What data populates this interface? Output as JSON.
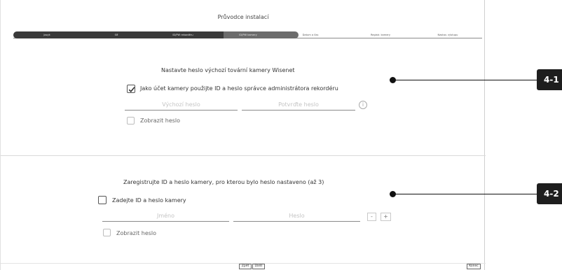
{
  "title": "Průvodce instalací",
  "steps": [
    {
      "label": "Jazyk"
    },
    {
      "label": "Síť"
    },
    {
      "label": "ID/PW rekordéru"
    },
    {
      "label": "ID/PW kamery"
    },
    {
      "label": "Datum a čas"
    },
    {
      "label": "Registr. kamery"
    },
    {
      "label": "Nastav. výstupu"
    }
  ],
  "section1": {
    "heading": "Nastavte heslo výchozí tovární kamery Wisenet",
    "use_recorder_checkbox_label": "Jako účet kamery použijte ID a heslo správce administrátora rekordéru",
    "use_recorder_checked": true,
    "default_password_placeholder": "Výchozí heslo",
    "confirm_password_placeholder": "Potvrďte heslo",
    "show_password_label": "Zobrazit heslo",
    "info_icon": "i"
  },
  "section2": {
    "heading": "Zaregistrujte ID a heslo kamery, pro kterou bylo heslo nastaveno (až 3)",
    "enter_id_checkbox_label": "Zadejte ID a heslo kamery",
    "name_placeholder": "Jméno",
    "password_placeholder": "Heslo",
    "minus_label": "-",
    "plus_label": "+",
    "show_password_label": "Zobrazit heslo"
  },
  "footer": {
    "back_label": "Zpět",
    "next_label": "Další",
    "finish_label": "Konec"
  },
  "callouts": {
    "c1": "4-1",
    "c2": "4-2"
  },
  "icons": {
    "check": "checkmark-icon",
    "info": "info-icon"
  }
}
